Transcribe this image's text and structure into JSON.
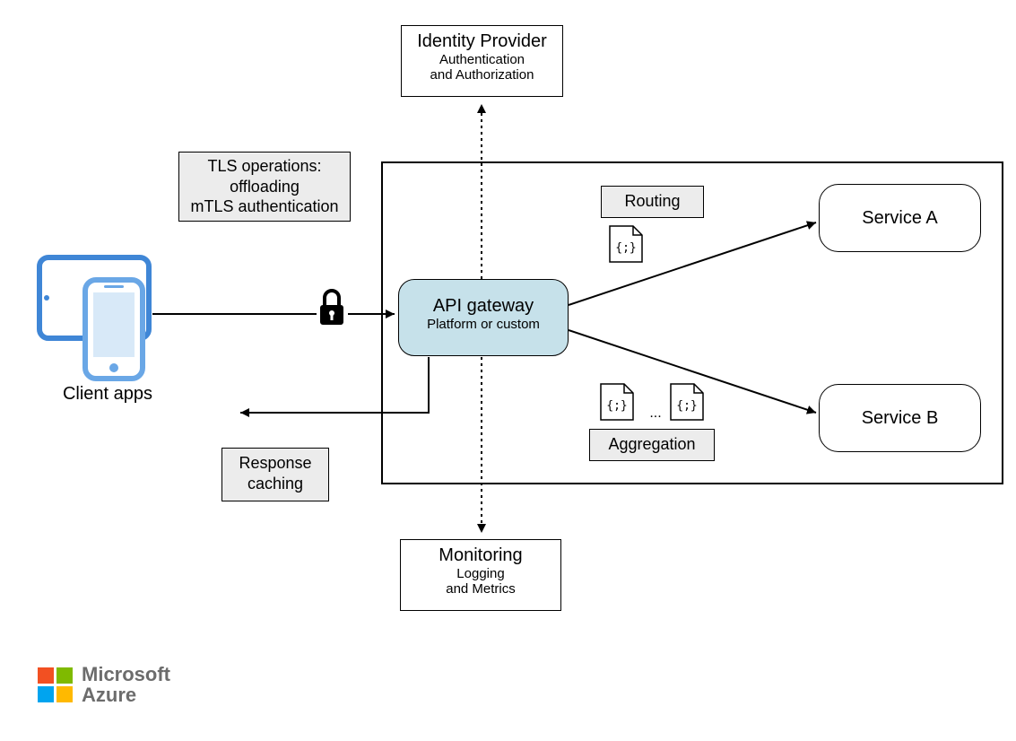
{
  "identityProvider": {
    "title": "Identity Provider",
    "sub1": "Authentication",
    "sub2": "and Authorization"
  },
  "tls": {
    "line1": "TLS operations:",
    "line2": "offloading",
    "line3": "mTLS authentication"
  },
  "clientApps": {
    "label": "Client apps"
  },
  "apiGateway": {
    "title": "API gateway",
    "sub": "Platform or custom"
  },
  "routing": {
    "label": "Routing"
  },
  "aggregation": {
    "label": "Aggregation",
    "ellipsis": "..."
  },
  "serviceA": {
    "label": "Service A"
  },
  "serviceB": {
    "label": "Service B"
  },
  "responseCaching": {
    "line1": "Response",
    "line2": "caching"
  },
  "monitoring": {
    "title": "Monitoring",
    "sub1": "Logging",
    "sub2": "and Metrics"
  },
  "brand": {
    "line1": "Microsoft",
    "line2": "Azure"
  },
  "colors": {
    "apiGatewayFill": "#c6e1ea",
    "greyFill": "#ececec",
    "deviceBlue": "#3f86d6",
    "deviceBlueLight": "#6aa7e6"
  }
}
